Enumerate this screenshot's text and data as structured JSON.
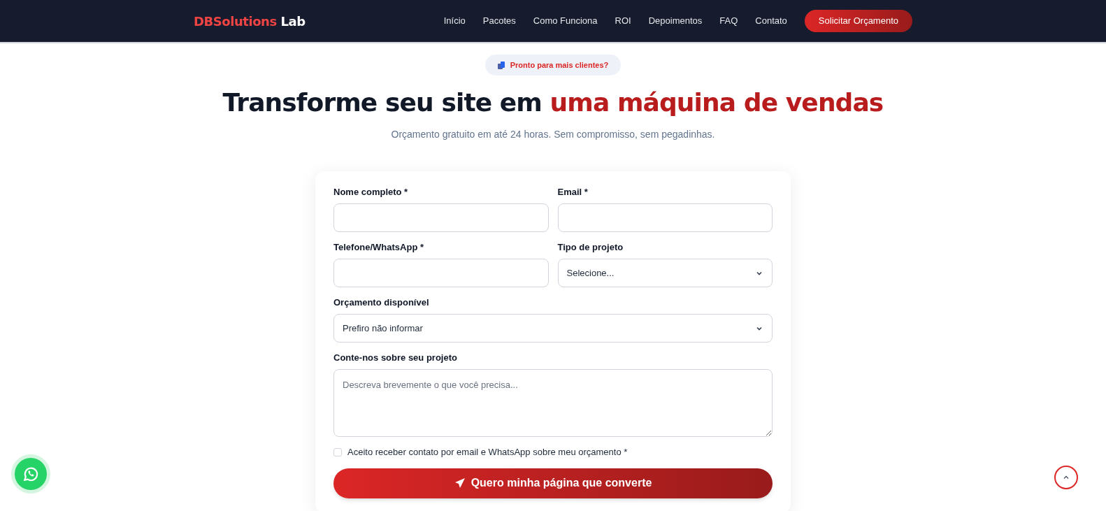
{
  "header": {
    "logo": {
      "main": "DBSolutions",
      "suffix": "Lab"
    },
    "nav": [
      {
        "label": "Início"
      },
      {
        "label": "Pacotes"
      },
      {
        "label": "Como Funciona"
      },
      {
        "label": "ROI"
      },
      {
        "label": "Depoimentos"
      },
      {
        "label": "FAQ"
      },
      {
        "label": "Contato"
      }
    ],
    "cta": "Solicitar Orçamento"
  },
  "hero": {
    "badge": "Pronto para mais clientes?",
    "title": "Transforme seu site em",
    "title_highlight": "uma máquina de vendas",
    "subtitle": "Orçamento gratuito em até 24 horas. Sem compromisso, sem pegadinhas."
  },
  "form": {
    "rows": [
      [
        {
          "kind": "input",
          "label": "Nome completo *"
        },
        {
          "kind": "input",
          "label": "Email *"
        }
      ],
      [
        {
          "kind": "input",
          "label": "Telefone/WhatsApp *"
        },
        {
          "kind": "select",
          "label": "Tipo de projeto",
          "value": "Selecione..."
        }
      ],
      [
        {
          "kind": "select",
          "label": "Orçamento disponível",
          "value": "Prefiro não informar"
        }
      ],
      [
        {
          "kind": "textarea",
          "label": "Conte-nos sobre seu projeto",
          "placeholder": "Descreva brevemente o que você precisa..."
        }
      ]
    ],
    "consent": {
      "label": "Aceito receber contato por email e WhatsApp sobre meu orçamento *",
      "checked": false
    },
    "submit": "Quero minha página que converte"
  }
}
